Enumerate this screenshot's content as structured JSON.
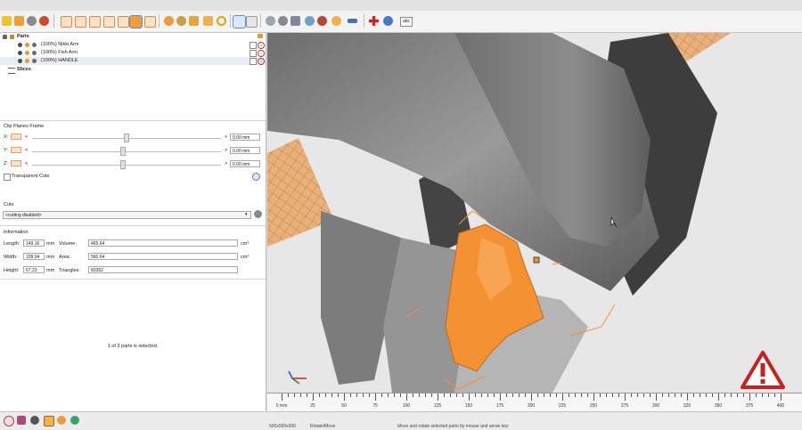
{
  "toolbar": {
    "text_style_label": "abc"
  },
  "tree": {
    "parts_label": "Parts",
    "parts": [
      {
        "label": "(100%) Nikki Arm"
      },
      {
        "label": "(100%) Fish Arm"
      },
      {
        "label": "(100%) HANDLE"
      }
    ],
    "slices_label": "Slices"
  },
  "clip": {
    "title": "Clip Planes Frame",
    "rows": [
      {
        "axis": "X:",
        "left": "<",
        "right": ">",
        "value": "0.00 mm",
        "position": 0.5
      },
      {
        "axis": "Y:",
        "left": "<",
        "right": ">",
        "value": "0.00 mm",
        "position": 0.48
      },
      {
        "axis": "Z:",
        "left": "<",
        "right": ">",
        "value": "0.00 mm",
        "position": 0.48
      }
    ],
    "transparent_label": "Transparent Cuts"
  },
  "cuts": {
    "title": "Cuts",
    "selected": "<cutting disabled>"
  },
  "info": {
    "title": "Information",
    "length_label": "Length:",
    "length_value": "149.16",
    "length_unit": "mm",
    "width_label": "Width:",
    "width_value": "109.94",
    "width_unit": "mm",
    "height_label": "Height:",
    "height_value": "67.23",
    "height_unit": "mm",
    "volume_label": "Volume:",
    "volume_value": "465.64",
    "volume_unit": "cm³",
    "area_label": "Area:",
    "area_value": "560.64",
    "area_unit": "cm²",
    "triangles_label": "Triangles:",
    "triangles_value": "83352"
  },
  "selection_status": "1 of 3 parts is selected.",
  "ruler": {
    "labels": [
      "0 mm",
      "25",
      "50",
      "75",
      "100",
      "125",
      "150",
      "175",
      "200",
      "225",
      "250",
      "275",
      "300",
      "325",
      "350",
      "375",
      "400"
    ]
  },
  "statusbar": {
    "size": "500x500x300",
    "mode": "Rotate/Move",
    "hint": "Move and rotate selected parts by mouse and arrow key"
  },
  "colors": {
    "accent": "#f0820f",
    "viewport_bg": "#e7e7e7",
    "warning": "#c91f1f",
    "plane": "#e8a46a"
  }
}
